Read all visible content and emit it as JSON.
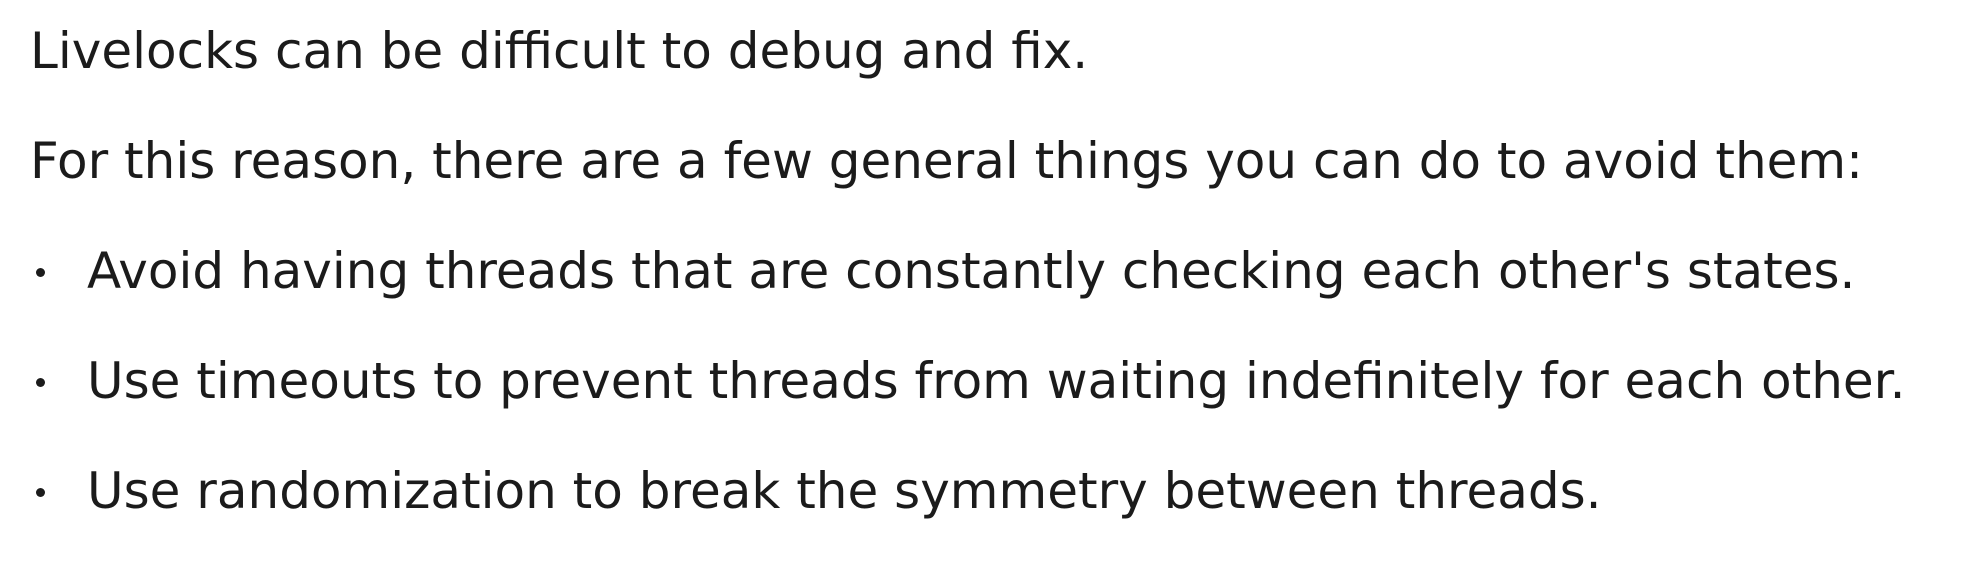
{
  "document": {
    "paragraphs": [
      "Livelocks can be difficult to debug and fix.",
      "For this reason, there are a few general things you can do to avoid them:"
    ],
    "bullets": [
      "Avoid having threads that are constantly checking each other's states.",
      "Use timeouts to prevent threads from waiting indefinitely for each other.",
      "Use randomization to break the symmetry between threads."
    ]
  }
}
